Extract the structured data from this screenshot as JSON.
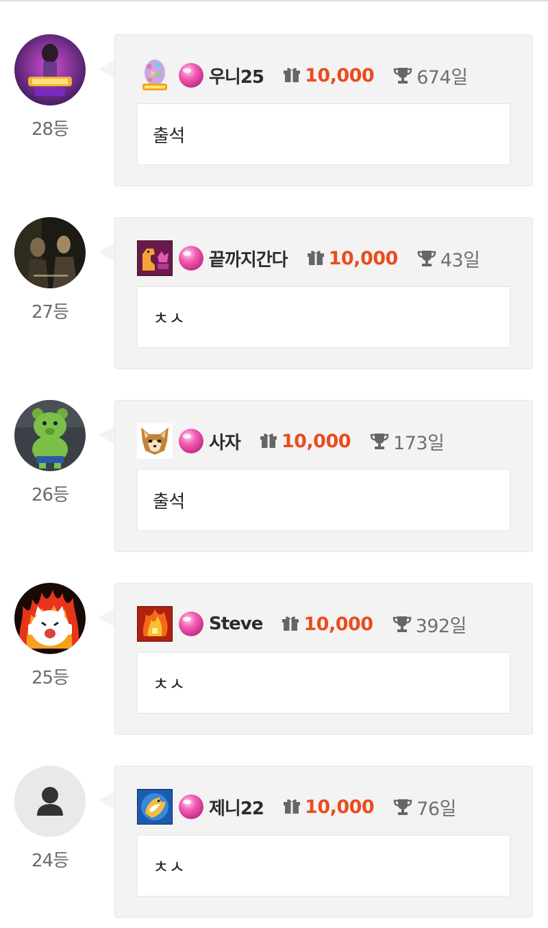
{
  "entries": [
    {
      "rank_label": "28등",
      "nickname": "우니25",
      "points": "10,000",
      "days": "674일",
      "message": "출석",
      "badge": "pixel-egg-badge",
      "avatar": "game-art-avatar"
    },
    {
      "rank_label": "27등",
      "nickname": "끝까지간다",
      "points": "10,000",
      "days": "43일",
      "message": "ㅊㅅ",
      "badge": "pixel-dino-badge",
      "avatar": "movie-scene-avatar"
    },
    {
      "rank_label": "26등",
      "nickname": "사자",
      "points": "10,000",
      "days": "173일",
      "message": "출석",
      "badge": "pixel-fox-badge",
      "avatar": "green-bear-avatar"
    },
    {
      "rank_label": "25등",
      "nickname": "Steve",
      "points": "10,000",
      "days": "392일",
      "message": "ㅊㅅ",
      "badge": "pixel-flame-badge",
      "avatar": "fire-cat-avatar"
    },
    {
      "rank_label": "24등",
      "nickname": "제니22",
      "points": "10,000",
      "days": "76일",
      "message": "ㅊㅅ",
      "badge": "pixel-dragon-badge",
      "avatar": "default-user-avatar"
    }
  ],
  "icons": {
    "level_gem": "pink-gem-icon",
    "gift": "gift-icon",
    "trophy": "trophy-icon"
  },
  "colors": {
    "points": "#ea4c1d",
    "card_bg": "#f3f3f3",
    "gem": "#f35fb4"
  }
}
